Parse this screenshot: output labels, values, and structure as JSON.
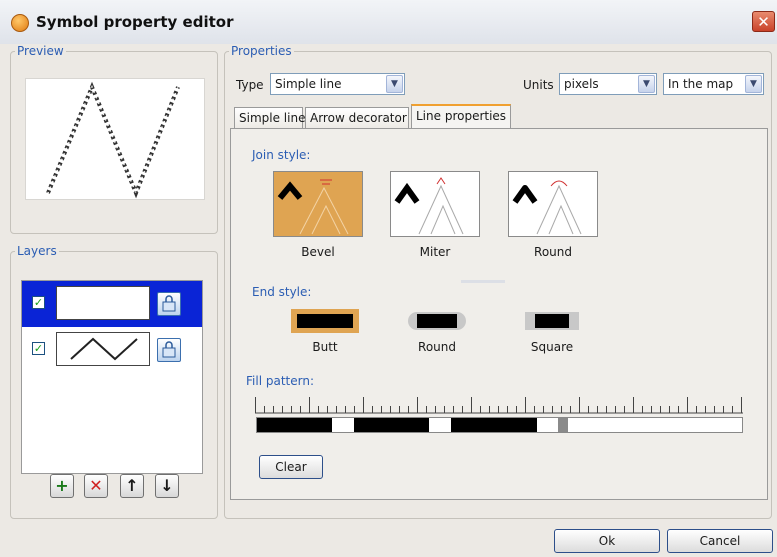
{
  "window": {
    "title": "Symbol property editor",
    "close_glyph": "✕"
  },
  "preview": {
    "legend": "Preview"
  },
  "layers": {
    "legend": "Layers",
    "items": [
      {
        "checked": true,
        "selected": true,
        "symbol": "empty"
      },
      {
        "checked": true,
        "selected": false,
        "symbol": "zigzag-line"
      }
    ],
    "toolbar": {
      "add": "+",
      "remove": "✕",
      "up": "↑",
      "down": "↓"
    }
  },
  "properties": {
    "legend": "Properties",
    "type_label": "Type",
    "type_value": "Simple line",
    "units_label": "Units",
    "units_value": "pixels",
    "reference_value": "In the map",
    "tabs": [
      {
        "label": "Simple line"
      },
      {
        "label": "Arrow decorator"
      },
      {
        "label": "Line properties"
      }
    ],
    "active_tab": 2,
    "join_style": {
      "label": "Join style:",
      "options": [
        {
          "label": "Bevel"
        },
        {
          "label": "Miter"
        },
        {
          "label": "Round"
        }
      ],
      "selected": 0
    },
    "end_style": {
      "label": "End style:",
      "options": [
        {
          "label": "Butt"
        },
        {
          "label": "Round"
        },
        {
          "label": "Square"
        }
      ],
      "selected": 0
    },
    "fill_pattern": {
      "label": "Fill pattern:",
      "clear_label": "Clear"
    }
  },
  "footer": {
    "ok_label": "Ok",
    "cancel_label": "Cancel"
  },
  "colors": {
    "accent": "#2b5db3",
    "selection": "#0a24d6",
    "selected_style": "#dfa452"
  }
}
